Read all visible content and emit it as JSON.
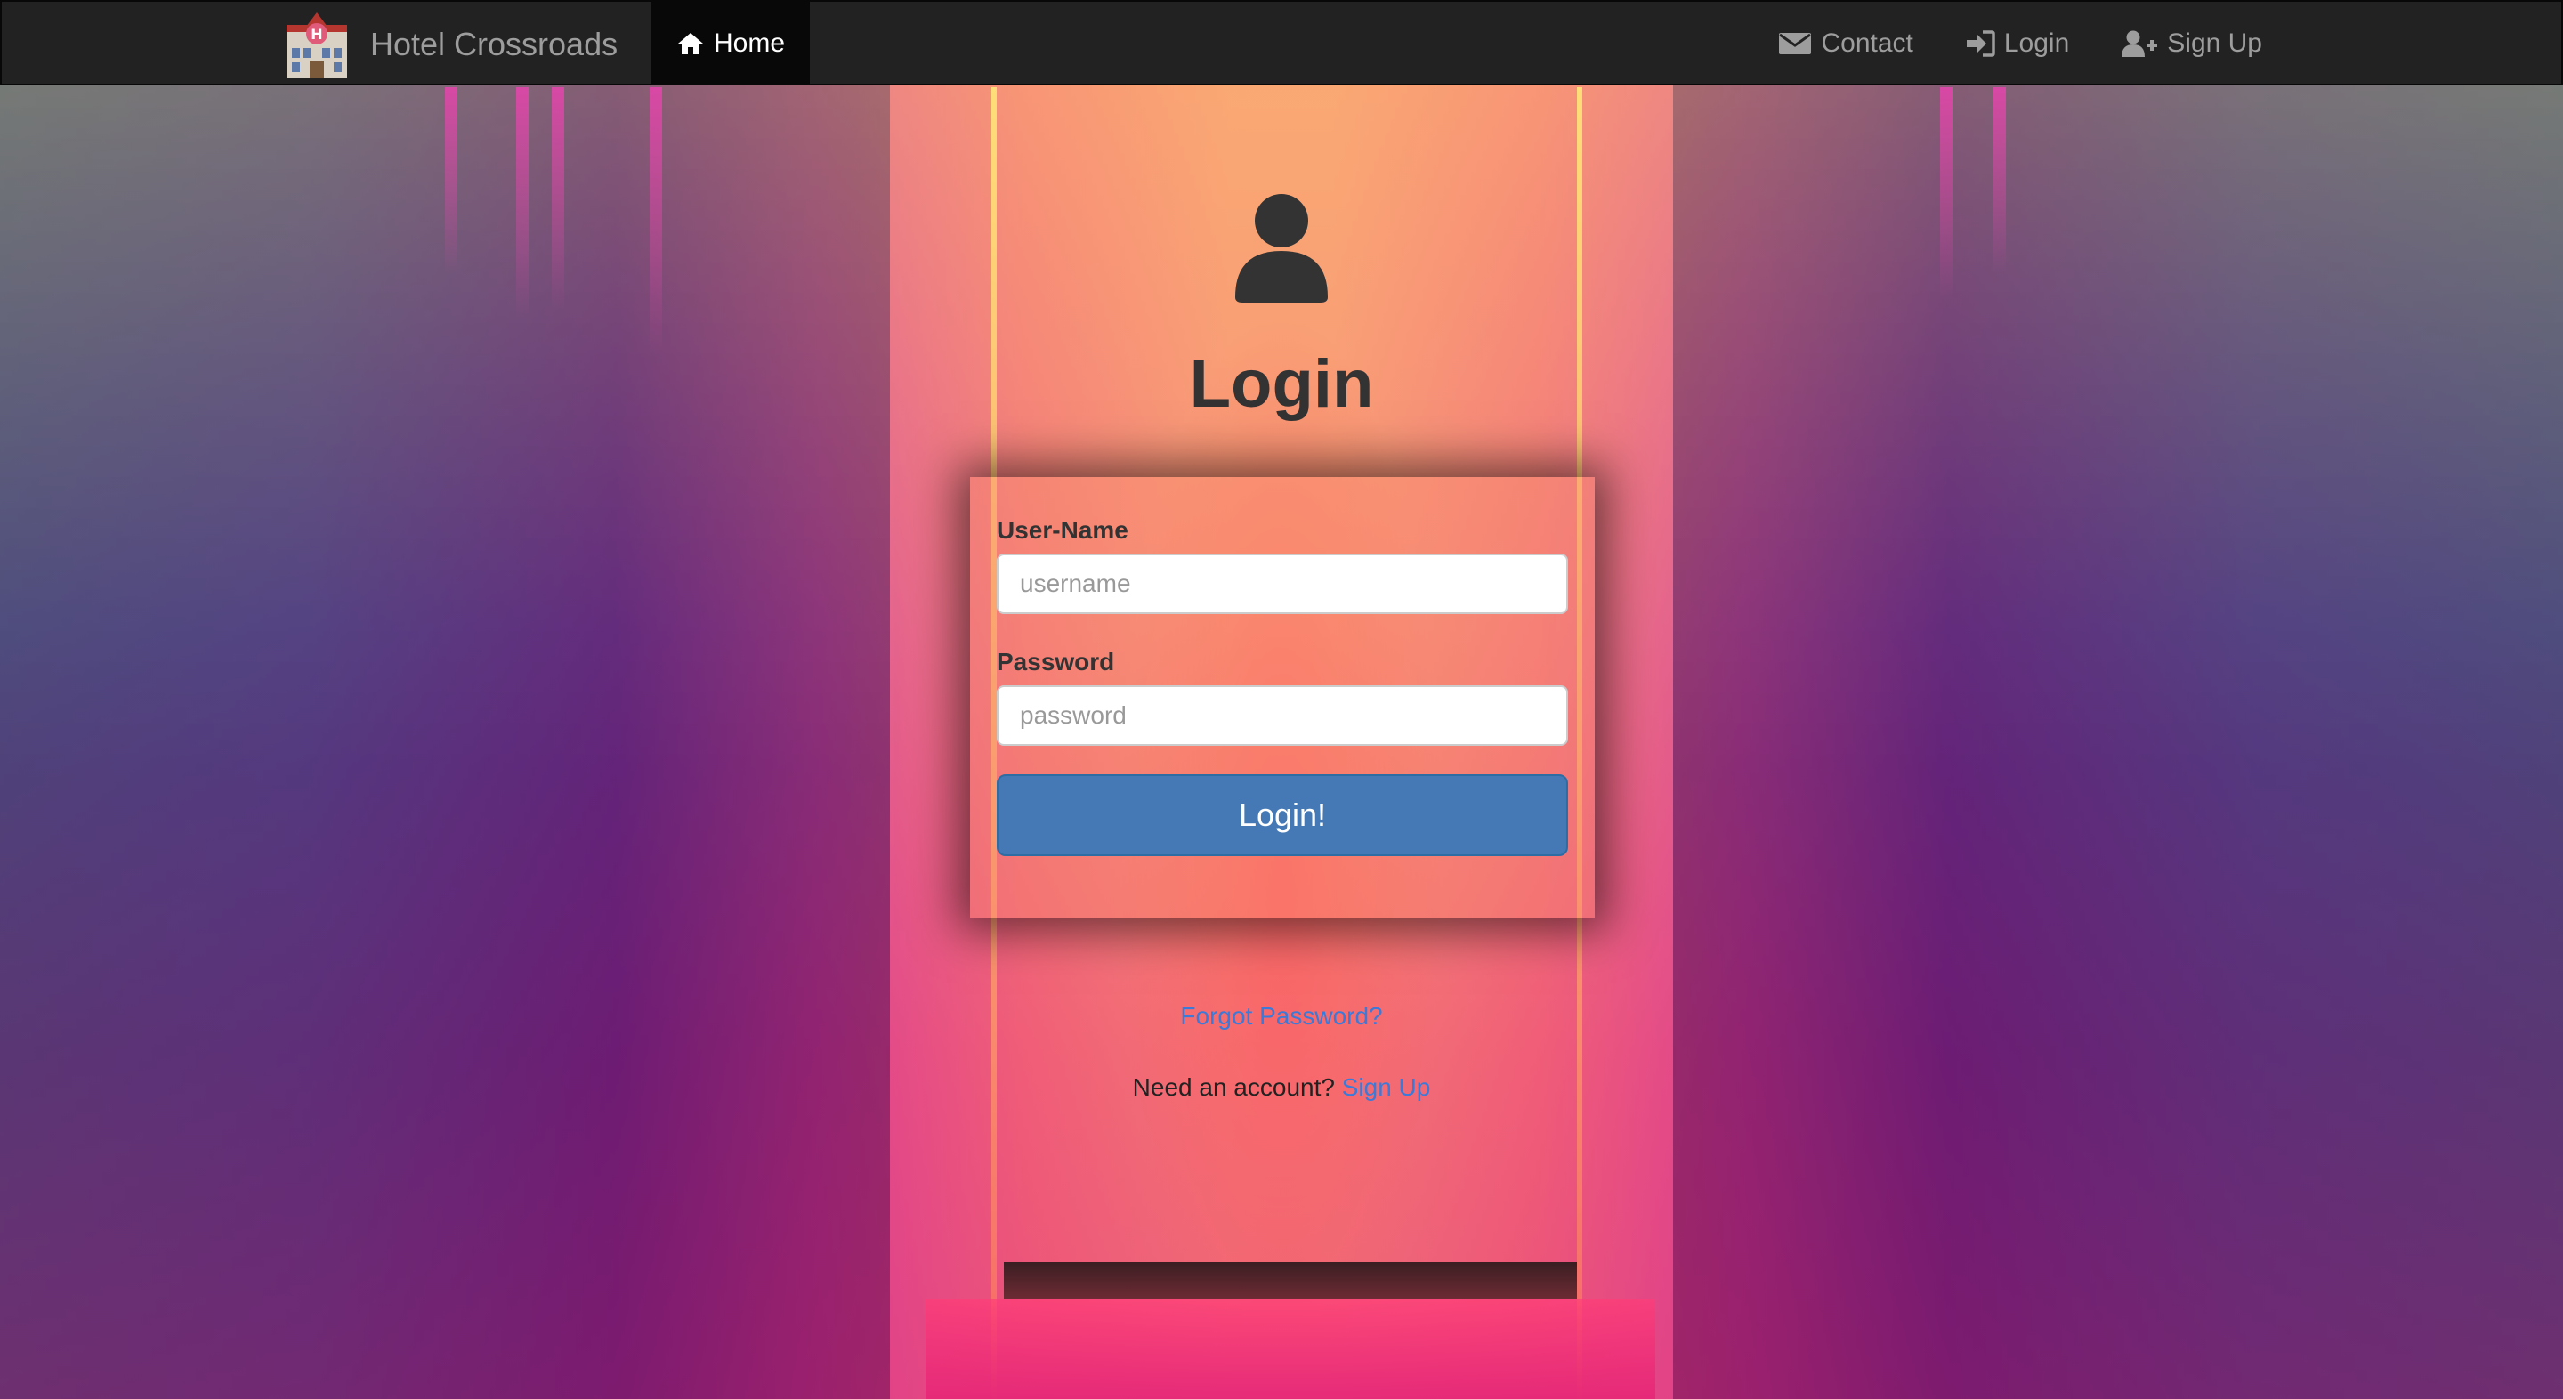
{
  "navbar": {
    "brand": "Hotel Crossroads",
    "home_label": "Home",
    "links": {
      "contact": "Contact",
      "login": "Login",
      "signup": "Sign Up"
    }
  },
  "login": {
    "title": "Login",
    "username_label": "User-Name",
    "username_placeholder": "username",
    "password_label": "Password",
    "password_placeholder": "password",
    "submit_label": "Login!",
    "forgot_link": "Forgot Password?",
    "signup_prompt": "Need an account?",
    "signup_link": "Sign Up"
  },
  "icons": {
    "brand": "hotel-icon",
    "home": "home-icon",
    "contact": "envelope-icon",
    "login": "login-icon",
    "signup": "user-plus-icon",
    "avatar": "user-icon"
  },
  "colors": {
    "navbar_bg": "#222222",
    "nav_active_bg": "#080808",
    "primary_button": "#4479b6",
    "link": "#3b7ad8",
    "title_text": "#333333"
  }
}
